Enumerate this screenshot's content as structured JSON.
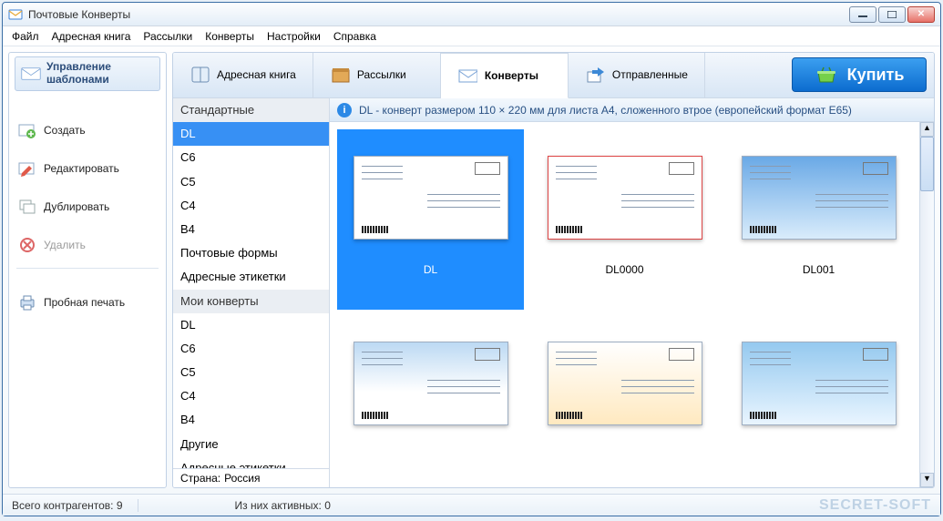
{
  "app": {
    "title": "Почтовые Конверты"
  },
  "menu": {
    "items": [
      "Файл",
      "Адресная книга",
      "Рассылки",
      "Конверты",
      "Настройки",
      "Справка"
    ]
  },
  "sidebar": {
    "title_line1": "Управление",
    "title_line2": "шаблонами",
    "actions": {
      "create": "Создать",
      "edit": "Редактировать",
      "duplicate": "Дублировать",
      "delete": "Удалить",
      "test_print": "Пробная печать"
    }
  },
  "tabs": {
    "address_book": "Адресная книга",
    "mailings": "Рассылки",
    "envelopes": "Конверты",
    "sent": "Отправленные"
  },
  "buy_button": "Купить",
  "categories": {
    "groups": [
      {
        "header": "Стандартные",
        "items": [
          "DL",
          "C6",
          "C5",
          "C4",
          "B4",
          "Почтовые формы",
          "Адресные этикетки"
        ]
      },
      {
        "header": "Мои конверты",
        "items": [
          "DL",
          "C6",
          "C5",
          "C4",
          "B4",
          "Другие",
          "Адресные этикетки"
        ]
      }
    ],
    "selected": "DL"
  },
  "info_text": "DL - конверт размером 110 × 220 мм для листа A4, сложенного втрое (европейский формат E65)",
  "country": {
    "label": "Страна:",
    "value": "Россия"
  },
  "thumbnails": [
    {
      "label": "DL",
      "selected": true,
      "variant": "plain"
    },
    {
      "label": "DL0000",
      "selected": false,
      "variant": "redborder"
    },
    {
      "label": "DL001",
      "selected": false,
      "variant": "sky"
    },
    {
      "label": "",
      "selected": false,
      "variant": "winter"
    },
    {
      "label": "",
      "selected": false,
      "variant": "feb23"
    },
    {
      "label": "",
      "selected": false,
      "variant": "plane"
    }
  ],
  "status": {
    "total_label": "Всего контрагентов:",
    "total_value": "9",
    "active_label": "Из них активных:",
    "active_value": "0"
  },
  "watermark": "SECRET-SOFT"
}
